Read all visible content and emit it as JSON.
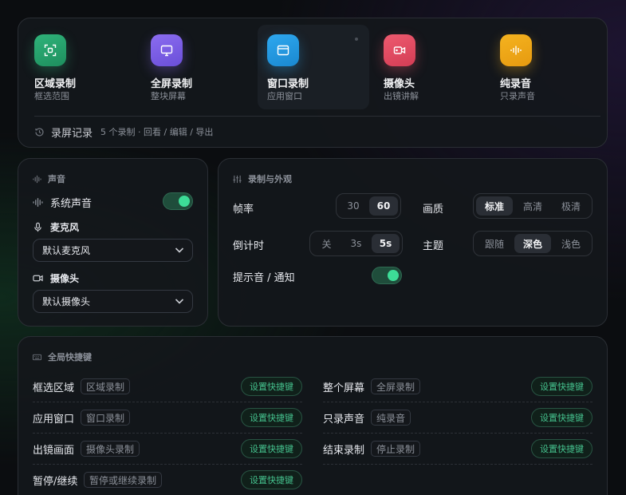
{
  "modes": [
    {
      "title": "区域录制",
      "sub": "框选范围",
      "icon": "region-select-icon",
      "color": "#2fb37a",
      "color2": "#1e8f5e",
      "active": false
    },
    {
      "title": "全屏录制",
      "sub": "整块屏幕",
      "icon": "monitor-icon",
      "color": "#8b6cf0",
      "color2": "#6a4fd8",
      "active": false
    },
    {
      "title": "窗口录制",
      "sub": "应用窗口",
      "icon": "window-icon",
      "color": "#2ea8ef",
      "color2": "#1a88d0",
      "active": true
    },
    {
      "title": "摄像头",
      "sub": "出镜讲解",
      "icon": "camera-icon",
      "color": "#ee5a6f",
      "color2": "#d33d55",
      "active": false
    },
    {
      "title": "纯录音",
      "sub": "只录声音",
      "icon": "audio-wave-icon",
      "color": "#f5b31f",
      "color2": "#e69a10",
      "active": false
    }
  ],
  "history": {
    "label": "录屏记录",
    "info": "5 个录制 · 回看 / 编辑 / 导出"
  },
  "sound": {
    "title": "声音",
    "system_audio": "系统声音",
    "system_audio_on": true,
    "mic_label": "麦克风",
    "mic_value": "默认麦克风",
    "cam_label": "摄像头",
    "cam_value": "默认摄像头"
  },
  "record": {
    "title": "录制与外观",
    "fps_label": "帧率",
    "fps_options": [
      "30",
      "60"
    ],
    "fps_selected": "60",
    "quality_label": "画质",
    "quality_options": [
      "标准",
      "高清",
      "极清"
    ],
    "quality_selected": "标准",
    "countdown_label": "倒计时",
    "countdown_options": [
      "关",
      "3s",
      "5s"
    ],
    "countdown_selected": "5s",
    "theme_label": "主题",
    "theme_options": [
      "跟随",
      "深色",
      "浅色"
    ],
    "theme_selected": "深色",
    "notify_label": "提示音 / 通知",
    "notify_on": true
  },
  "shortcuts": {
    "title": "全局快捷键",
    "button": "设置快捷键",
    "left": [
      {
        "name": "框选区域",
        "tag": "区域录制"
      },
      {
        "name": "应用窗口",
        "tag": "窗口录制"
      },
      {
        "name": "出镜画面",
        "tag": "摄像头录制"
      },
      {
        "name": "暂停/继续",
        "tag": "暂停或继续录制"
      }
    ],
    "right": [
      {
        "name": "整个屏幕",
        "tag": "全屏录制"
      },
      {
        "name": "只录声音",
        "tag": "纯录音"
      },
      {
        "name": "结束录制",
        "tag": "停止录制"
      }
    ]
  }
}
